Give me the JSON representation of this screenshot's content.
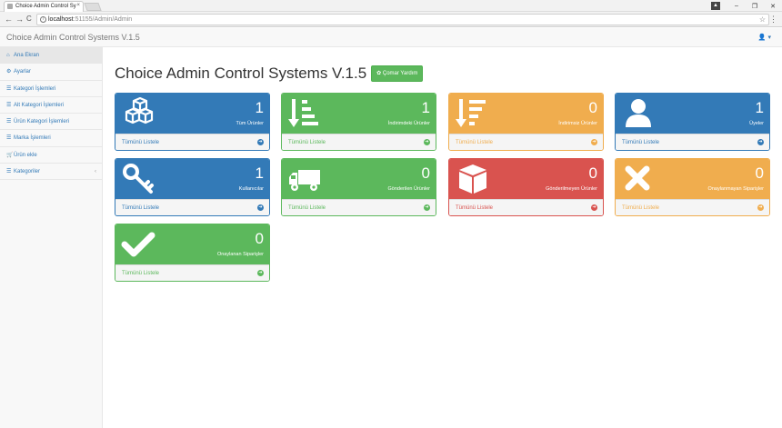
{
  "browser": {
    "tab_title": "Choice Admin Control Sy",
    "tab_close": "×",
    "url_host": "localhost",
    "url_path": ":51155/Admin/Admin",
    "back": "←",
    "forward": "→",
    "reload": "C",
    "star": "☆",
    "menu": "⋮",
    "profile": "▲",
    "minimize": "–",
    "maximize": "❐",
    "close": "✕"
  },
  "app": {
    "brand": "Choice Admin Control Systems V.1.5",
    "user_menu": "👤 ▾"
  },
  "sidebar": {
    "items": [
      {
        "icon": "⌂",
        "label": "Ana Ekran"
      },
      {
        "icon": "⚙",
        "label": "Ayarlar"
      },
      {
        "icon": "☰",
        "label": "Kategori İşlemleri"
      },
      {
        "icon": "☰",
        "label": "Alt Kategori İşlemleri"
      },
      {
        "icon": "☰",
        "label": "Ürün Kategori İşlemleri"
      },
      {
        "icon": "☰",
        "label": "Marka İşlemleri"
      },
      {
        "icon": "🛒",
        "label": "Ürün ekle"
      },
      {
        "icon": "☰",
        "label": "Kategoriler",
        "caret": "‹"
      }
    ]
  },
  "main": {
    "title": "Choice Admin Control Systems V.1.5",
    "help_button": "✿ Çomar Yardım",
    "panels": [
      {
        "count": "1",
        "label": "Tüm Ürünler",
        "link": "Tümünü Listele",
        "color": "#337ab7",
        "icon": "cubes-icon"
      },
      {
        "count": "1",
        "label": "İndirimdeki Ürünler",
        "link": "Tümünü Listele",
        "color": "#5cb85c",
        "icon": "sort-amount-down-icon"
      },
      {
        "count": "0",
        "label": "İndirimsiz Ürünler",
        "link": "Tümünü Listele",
        "color": "#f0ad4e",
        "icon": "sort-amount-down-icon"
      },
      {
        "count": "1",
        "label": "Üyeler",
        "link": "Tümünü Listele",
        "color": "#337ab7",
        "icon": "user-icon"
      },
      {
        "count": "1",
        "label": "Kullanıcılar",
        "link": "Tümünü Listele",
        "color": "#337ab7",
        "icon": "key-icon"
      },
      {
        "count": "0",
        "label": "Gönderilen Ürünler",
        "link": "Tümünü Listele",
        "color": "#5cb85c",
        "icon": "truck-icon"
      },
      {
        "count": "0",
        "label": "Gönderilmeyen Ürünler",
        "link": "Tümünü Listele",
        "color": "#d9534f",
        "icon": "cube-icon"
      },
      {
        "count": "0",
        "label": "Onaylanmayan Siparişler",
        "link": "Tümünü Listele",
        "color": "#f0ad4e",
        "icon": "times-icon"
      },
      {
        "count": "0",
        "label": "Onaylanan Siparişler",
        "link": "Tümünü Listele",
        "color": "#5cb85c",
        "icon": "check-icon"
      }
    ],
    "panel_arrow": "➜"
  }
}
